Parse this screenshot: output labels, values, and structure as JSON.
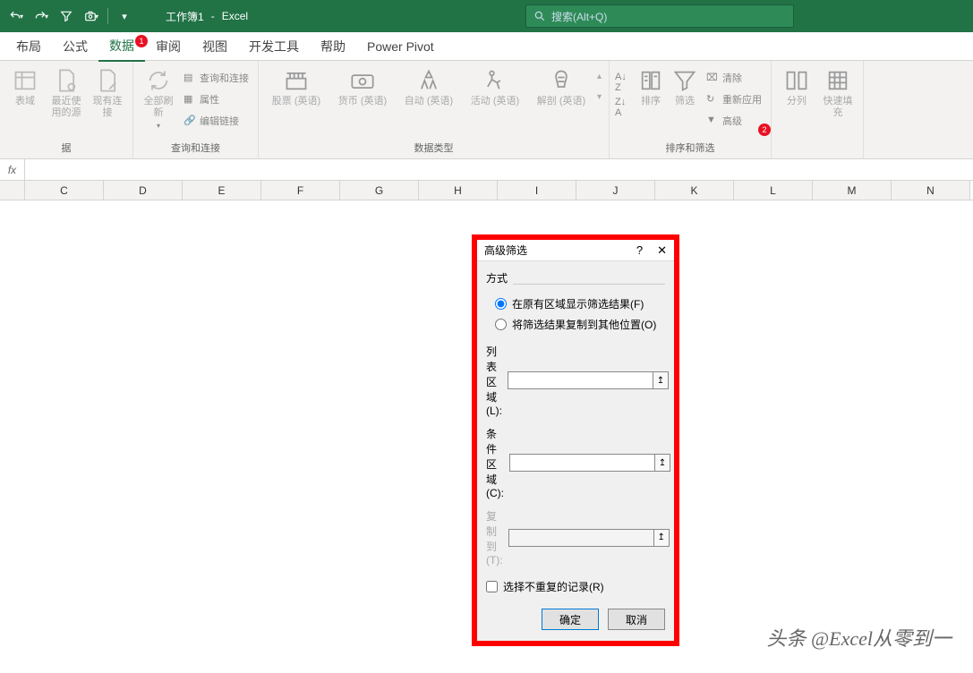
{
  "title": {
    "workbook": "工作簿1",
    "app": "Excel"
  },
  "search": {
    "placeholder": "搜索(Alt+Q)"
  },
  "tabs": {
    "items": [
      "布局",
      "公式",
      "数据",
      "审阅",
      "视图",
      "开发工具",
      "帮助",
      "Power Pivot"
    ],
    "active_index": 2,
    "badge1": "1"
  },
  "ribbon": {
    "group_get": {
      "btn1": "表域",
      "btn2": "最近使用的源",
      "btn3": "现有连接",
      "label": "据"
    },
    "group_conn": {
      "refresh": "全部刷新",
      "q1": "查询和连接",
      "q2": "属性",
      "q3": "编辑链接",
      "label": "查询和连接"
    },
    "group_types": {
      "t1": "股票 (英语)",
      "t2": "货币 (英语)",
      "t3": "自动 (英语)",
      "t4": "活动 (英语)",
      "t5": "解剖 (英语)",
      "label": "数据类型"
    },
    "group_sort": {
      "sort": "排序",
      "filter": "筛选",
      "clear": "清除",
      "reapply": "重新应用",
      "advanced": "高级",
      "label": "排序和筛选",
      "badge2": "2"
    },
    "group_tools": {
      "split": "分列",
      "flash": "快速填充"
    }
  },
  "formula_bar": {
    "fx": "fx"
  },
  "columns": [
    "C",
    "D",
    "E",
    "F",
    "G",
    "H",
    "I",
    "J",
    "K",
    "L",
    "M",
    "N"
  ],
  "dialog": {
    "title": "高级筛选",
    "help": "?",
    "close": "✕",
    "mode_label": "方式",
    "radio1": "在原有区域显示筛选结果(F)",
    "radio2": "将筛选结果复制到其他位置(O)",
    "list_label": "列表区域(L):",
    "crit_label": "条件区域(C):",
    "copy_label": "复制到(T):",
    "unique_label": "选择不重复的记录(R)",
    "ok": "确定",
    "cancel": "取消",
    "list_val": "",
    "crit_val": "",
    "copy_val": ""
  },
  "watermark": "头条 @Excel从零到一"
}
